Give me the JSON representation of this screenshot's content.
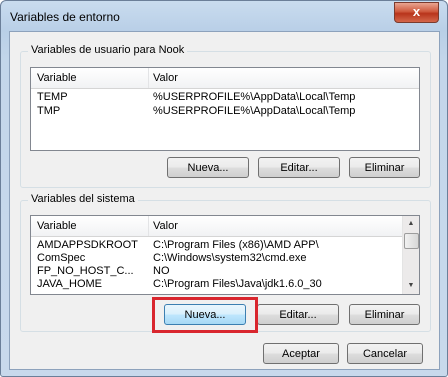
{
  "window": {
    "title": "Variables de entorno",
    "close_label": "x"
  },
  "user_vars": {
    "group_label": "Variables de usuario para Nook",
    "columns": [
      "Variable",
      "Valor"
    ],
    "rows": [
      {
        "name": "TEMP",
        "value": "%USERPROFILE%\\AppData\\Local\\Temp"
      },
      {
        "name": "TMP",
        "value": "%USERPROFILE%\\AppData\\Local\\Temp"
      }
    ],
    "buttons": {
      "new": "Nueva...",
      "edit": "Editar...",
      "delete": "Eliminar"
    }
  },
  "system_vars": {
    "group_label": "Variables del sistema",
    "columns": [
      "Variable",
      "Valor"
    ],
    "rows": [
      {
        "name": "AMDAPPSDKROOT",
        "value": "C:\\Program Files (x86)\\AMD APP\\"
      },
      {
        "name": "ComSpec",
        "value": "C:\\Windows\\system32\\cmd.exe"
      },
      {
        "name": "FP_NO_HOST_C...",
        "value": "NO"
      },
      {
        "name": "JAVA_HOME",
        "value": "C:\\Program Files\\Java\\jdk1.6.0_30"
      }
    ],
    "buttons": {
      "new": "Nueva...",
      "edit": "Editar...",
      "delete": "Eliminar"
    }
  },
  "footer": {
    "ok": "Aceptar",
    "cancel": "Cancelar"
  },
  "colors": {
    "highlight": "#d9262e",
    "title_bar": "#c9dcef",
    "close": "#c4452a"
  }
}
